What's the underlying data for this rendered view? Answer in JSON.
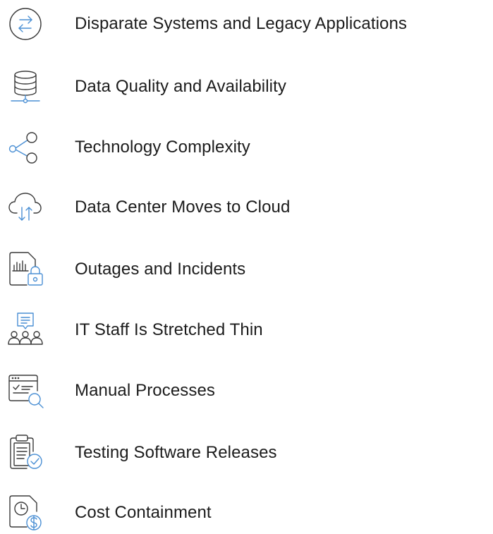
{
  "items": [
    {
      "label": "Disparate Systems and Legacy Applications",
      "icon": "arrows-exchange-icon"
    },
    {
      "label": "Data Quality and Availability",
      "icon": "database-icon"
    },
    {
      "label": "Technology Complexity",
      "icon": "share-nodes-icon"
    },
    {
      "label": "Data Center Moves to Cloud",
      "icon": "cloud-transfer-icon"
    },
    {
      "label": "Outages and Incidents",
      "icon": "report-lock-icon"
    },
    {
      "label": "IT Staff Is Stretched Thin",
      "icon": "team-chat-icon"
    },
    {
      "label": "Manual Processes",
      "icon": "checklist-search-icon"
    },
    {
      "label": "Testing Software Releases",
      "icon": "clipboard-check-icon"
    },
    {
      "label": "Cost Containment",
      "icon": "clock-dollar-icon"
    }
  ],
  "colors": {
    "text": "#1c1c1c",
    "icon_stroke": "#3a3a3a",
    "accent": "#4a8fd4"
  }
}
